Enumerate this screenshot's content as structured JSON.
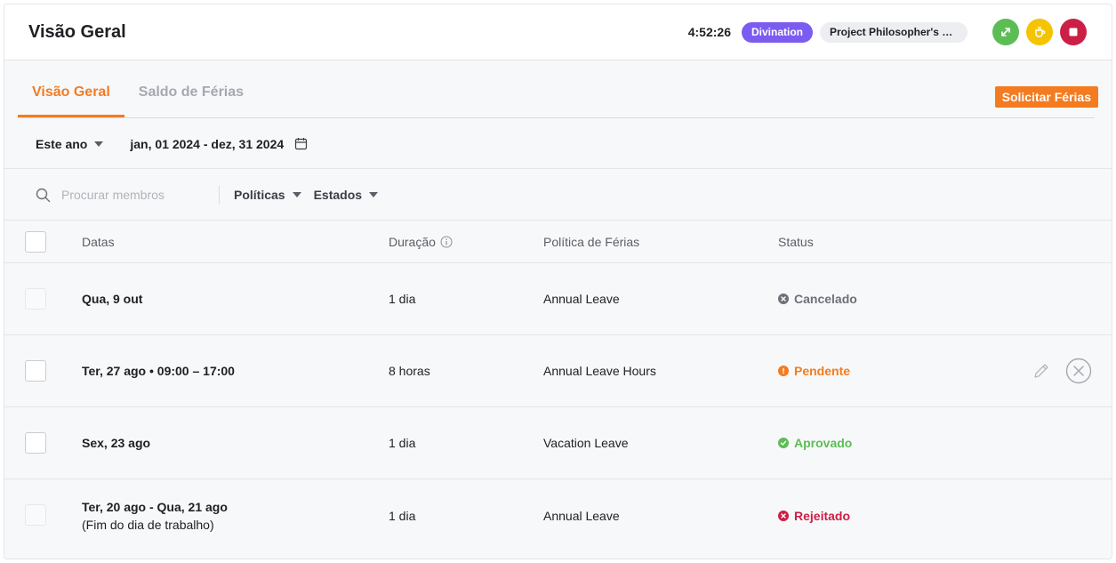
{
  "header": {
    "title": "Visão Geral",
    "timer": "4:52:26",
    "project": "Divination",
    "task": "Project Philosopher's S...",
    "colors": {
      "project": "#7b5cf0",
      "green": "#5cbd54",
      "yellow": "#f5c400",
      "red": "#cc1f45"
    }
  },
  "tabs": [
    {
      "label": "Visão Geral",
      "active": true
    },
    {
      "label": "Saldo de Férias",
      "active": false
    }
  ],
  "request_button": "Solicitar Férias",
  "period": {
    "selected": "Este ano",
    "range": "jan, 01 2024 - dez, 31 2024"
  },
  "filters": {
    "search_placeholder": "Procurar membros",
    "policies": "Políticas",
    "states": "Estados"
  },
  "table": {
    "columns": {
      "dates": "Datas",
      "duration": "Duração",
      "policy": "Política de Férias",
      "status": "Status"
    },
    "rows": [
      {
        "date": "Qua, 9 out",
        "sub": "",
        "duration": "1 dia",
        "policy": "Annual Leave",
        "status": "Cancelado",
        "status_color": "#6e7078",
        "status_icon": "x-circle-icon"
      },
      {
        "date": "Ter, 27 ago • 09:00 – 17:00",
        "sub": "",
        "duration": "8 horas",
        "policy": "Annual Leave Hours",
        "status": "Pendente",
        "status_color": "#f47b20",
        "status_icon": "exclamation-circle-icon"
      },
      {
        "date": "Sex, 23 ago",
        "sub": "",
        "duration": "1 dia",
        "policy": "Vacation Leave",
        "status": "Aprovado",
        "status_color": "#5cbd54",
        "status_icon": "check-circle-icon"
      },
      {
        "date": "Ter, 20 ago - Qua, 21 ago",
        "sub": "(Fim do dia de trabalho)",
        "duration": "1 dia",
        "policy": "Annual Leave",
        "status": "Rejeitado",
        "status_color": "#cc1f45",
        "status_icon": "x-circle-icon"
      }
    ]
  }
}
